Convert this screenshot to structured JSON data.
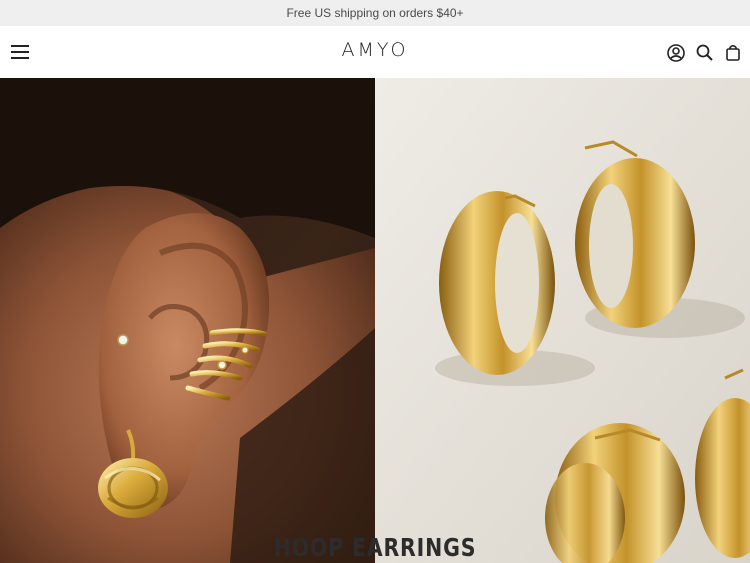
{
  "announcement": {
    "text": "Free US shipping on orders $40+"
  },
  "header": {
    "logo": "AMYO",
    "icons": [
      "menu-icon",
      "account-icon",
      "search-icon",
      "bag-icon"
    ]
  },
  "hero": {
    "title": "HOOP EARRINGS",
    "left_image": "ear with gold cuffs and twisted hoop",
    "right_image": "gold chunky hoop earrings"
  },
  "colors": {
    "announcement_bg": "#efefef",
    "text_dark": "#2c2c2c",
    "gold": "#d6a933",
    "right_bg": "#e9e5dc"
  }
}
